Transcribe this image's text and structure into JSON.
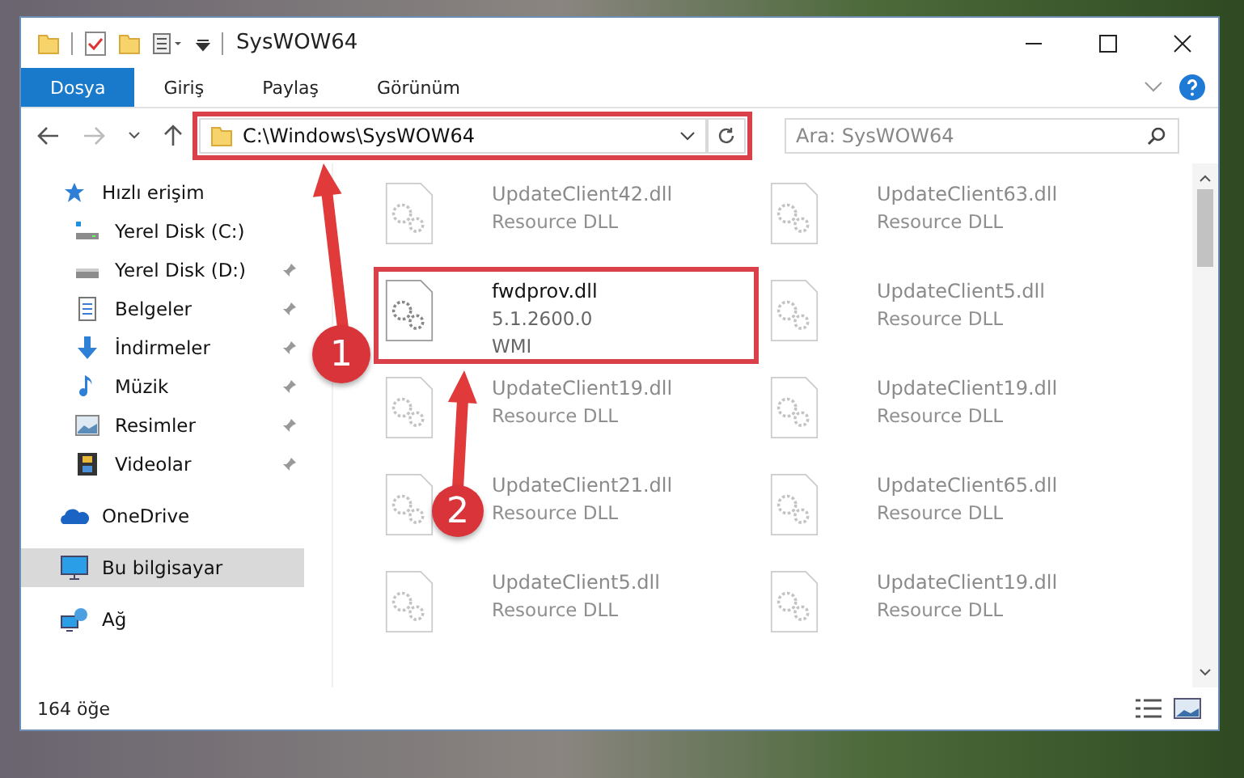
{
  "window": {
    "title": "SysWOW64"
  },
  "ribbon_tabs": [
    {
      "label": "Dosya",
      "selected": true
    },
    {
      "label": "Giriş",
      "selected": false
    },
    {
      "label": "Paylaş",
      "selected": false
    },
    {
      "label": "Görünüm",
      "selected": false
    }
  ],
  "address_bar": {
    "path": "C:\\Windows\\SysWOW64"
  },
  "search": {
    "placeholder": "Ara: SysWOW64"
  },
  "sidebar": {
    "items": [
      {
        "label": "Hızlı erişim",
        "kind": "star",
        "selected": false,
        "pinned": false,
        "children": [
          {
            "label": "Yerel Disk (C:)",
            "kind": "system-drive",
            "selected": false,
            "pinned": false
          },
          {
            "label": "Yerel Disk (D:)",
            "kind": "drive",
            "selected": false,
            "pinned": true
          },
          {
            "label": "Belgeler",
            "kind": "documents",
            "selected": false,
            "pinned": true
          },
          {
            "label": "İndirmeler",
            "kind": "download",
            "selected": false,
            "pinned": true
          },
          {
            "label": "Müzik",
            "kind": "music",
            "selected": false,
            "pinned": true
          },
          {
            "label": "Resimler",
            "kind": "pictures",
            "selected": false,
            "pinned": true
          },
          {
            "label": "Videolar",
            "kind": "videos",
            "selected": false,
            "pinned": true
          }
        ]
      },
      {
        "label": "OneDrive",
        "kind": "cloud",
        "selected": false,
        "pinned": false
      },
      {
        "label": "Bu bilgisayar",
        "kind": "computer",
        "selected": true,
        "pinned": false
      },
      {
        "label": "Ağ",
        "kind": "network",
        "selected": false,
        "pinned": false
      }
    ]
  },
  "files": [
    {
      "name": "UpdateClient42.dll",
      "details": [
        "Resource DLL"
      ],
      "highlighted": false
    },
    {
      "name": "UpdateClient63.dll",
      "details": [
        "Resource DLL"
      ],
      "highlighted": false
    },
    {
      "name": "fwdprov.dll",
      "details": [
        "5.1.2600.0",
        "WMI"
      ],
      "highlighted": true
    },
    {
      "name": "UpdateClient5.dll",
      "details": [
        "Resource DLL"
      ],
      "highlighted": false
    },
    {
      "name": "UpdateClient19.dll",
      "details": [
        "Resource DLL"
      ],
      "highlighted": false
    },
    {
      "name": "UpdateClient19.dll",
      "details": [
        "Resource DLL"
      ],
      "highlighted": false
    },
    {
      "name": "UpdateClient21.dll",
      "details": [
        "Resource DLL"
      ],
      "highlighted": false
    },
    {
      "name": "UpdateClient65.dll",
      "details": [
        "Resource DLL"
      ],
      "highlighted": false
    },
    {
      "name": "UpdateClient5.dll",
      "details": [
        "Resource DLL"
      ],
      "highlighted": false
    },
    {
      "name": "UpdateClient19.dll",
      "details": [
        "Resource DLL"
      ],
      "highlighted": false
    }
  ],
  "status_bar": {
    "item_count": "164 öğe"
  },
  "annotations": [
    {
      "number": "1"
    },
    {
      "number": "2"
    }
  ]
}
